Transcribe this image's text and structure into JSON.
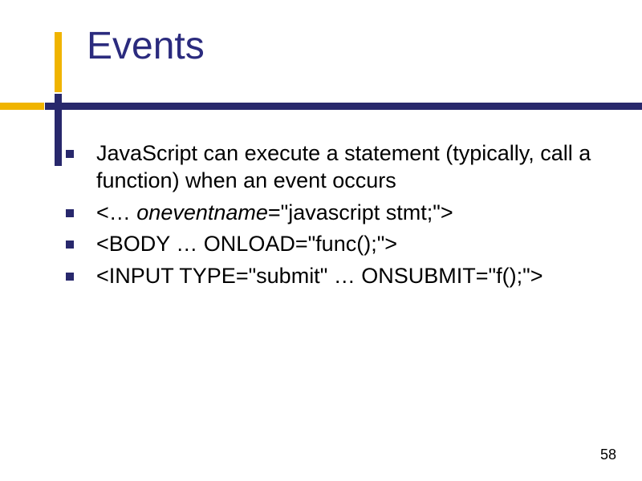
{
  "title": "Events",
  "bullets": [
    {
      "text": "JavaScript can execute a statement (typically, call a function) when an event occurs"
    },
    {
      "prefix": "<… ",
      "italic": "oneventname",
      "suffix": "=\"javascript stmt;\">"
    },
    {
      "text": "<BODY … ONLOAD=\"func();\">"
    },
    {
      "text": "<INPUT TYPE=\"submit\" … ONSUBMIT=\"f();\">"
    }
  ],
  "page_number": "58"
}
